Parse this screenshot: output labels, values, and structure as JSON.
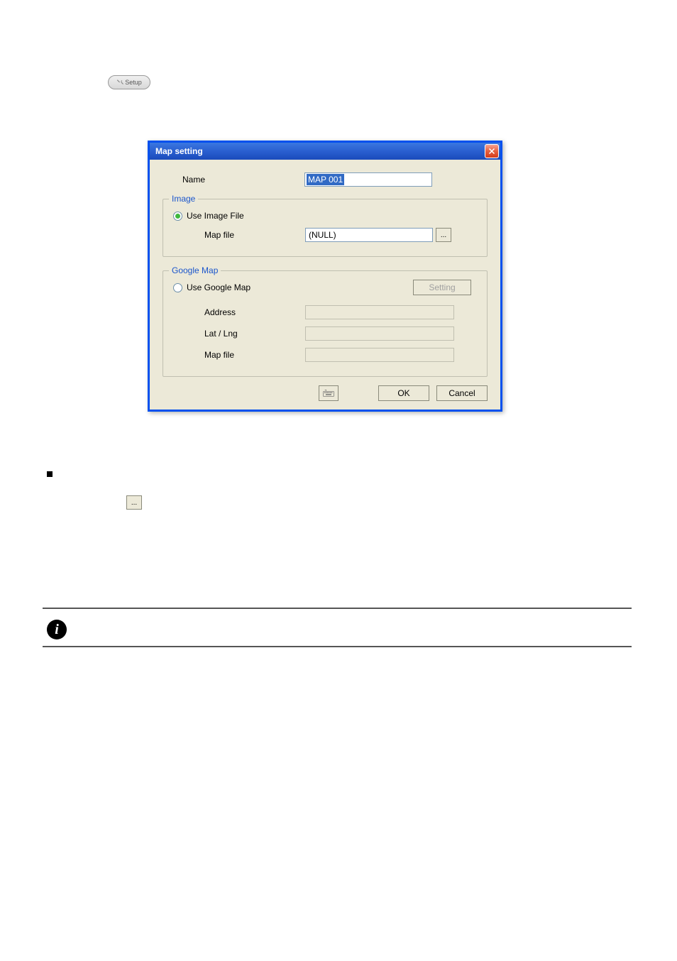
{
  "setup_button": {
    "label": "Setup"
  },
  "dialog": {
    "title": "Map setting",
    "name_label": "Name",
    "name_value": "MAP 001",
    "image_group": {
      "legend": "Image",
      "use_image_label": "Use Image File",
      "map_file_label": "Map file",
      "map_file_value": "(NULL)",
      "browse_label": "..."
    },
    "google_group": {
      "legend": "Google Map",
      "use_google_label": "Use Google Map",
      "setting_button": "Setting",
      "address_label": "Address",
      "address_value": "",
      "latlng_label": "Lat / Lng",
      "latlng_value": "",
      "map_file_label": "Map file",
      "map_file_value": ""
    },
    "footer": {
      "ok": "OK",
      "cancel": "Cancel"
    }
  },
  "inline_browse_label": "...",
  "info_glyph": "i"
}
